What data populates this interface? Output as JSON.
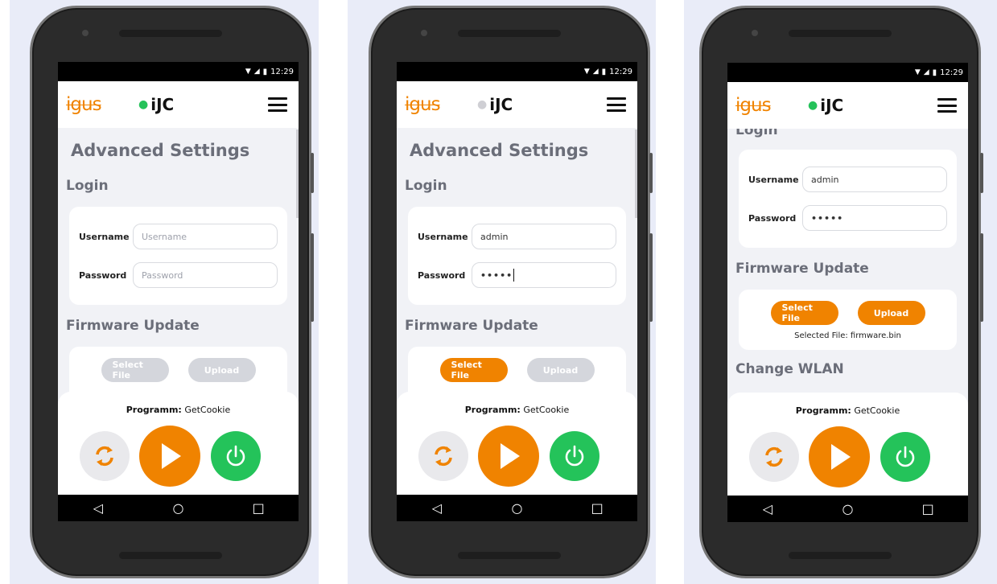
{
  "screens": [
    {
      "status": {
        "time": "12:29"
      },
      "header": {
        "brand": "igus",
        "title": "iJC"
      },
      "page_title": "Advanced Settings",
      "login": {
        "title": "Login",
        "username_label": "Username",
        "password_label": "Password",
        "username_value": "",
        "username_placeholder": "Username",
        "password_value": "",
        "password_placeholder": "Password"
      },
      "firmware": {
        "title": "Firmware Update",
        "select_label": "Select File",
        "upload_label": "Upload",
        "select_enabled": false,
        "upload_enabled": false
      },
      "bottom": {
        "programm_label": "Programm:",
        "programm_value": "GetCookie"
      }
    },
    {
      "status": {
        "time": "12:29"
      },
      "header": {
        "brand": "igus",
        "title": "iJC"
      },
      "page_title": "Advanced Settings",
      "login": {
        "title": "Login",
        "username_label": "Username",
        "password_label": "Password",
        "username_value": "admin",
        "username_placeholder": "Username",
        "password_value": "•••••",
        "password_placeholder": "Password"
      },
      "firmware": {
        "title": "Firmware Update",
        "select_label": "Select File",
        "upload_label": "Upload",
        "select_enabled": true,
        "upload_enabled": false
      },
      "bottom": {
        "programm_label": "Programm:",
        "programm_value": "GetCookie"
      }
    },
    {
      "status": {
        "time": "12:29"
      },
      "header": {
        "brand": "igus",
        "title": "iJC"
      },
      "login": {
        "title": "Login",
        "username_label": "Username",
        "password_label": "Password",
        "username_value": "admin",
        "username_placeholder": "Username",
        "password_value": "•••••",
        "password_placeholder": "Password"
      },
      "firmware": {
        "title": "Firmware Update",
        "select_label": "Select File",
        "upload_label": "Upload",
        "select_enabled": true,
        "upload_enabled": true,
        "selected_file_text": "Selected File: firmware.bin"
      },
      "wlan": {
        "title": "Change WLAN"
      },
      "bottom": {
        "programm_label": "Programm:",
        "programm_value": "GetCookie"
      }
    }
  ],
  "icons": [
    "wifi-icon",
    "signal-icon",
    "battery-icon",
    "hamburger-menu-icon",
    "refresh-icon",
    "play-icon",
    "power-icon",
    "back-icon",
    "home-icon",
    "recents-icon"
  ],
  "colors": {
    "accent_orange": "#f08300",
    "power_green": "#24c35a",
    "disabled_gray": "#d4d6dc",
    "app_background": "#f1f2f6"
  }
}
